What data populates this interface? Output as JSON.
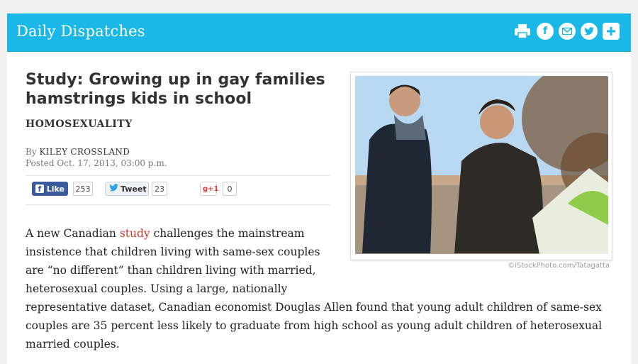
{
  "header": {
    "brand": "Daily Dispatches",
    "icons": [
      "printer-icon",
      "facebook-icon",
      "email-icon",
      "twitter-icon",
      "plus-icon"
    ]
  },
  "article": {
    "title_line1": "Study: Growing up in gay families",
    "title_line2": "hamstrings kids in school",
    "category": "HOMOSEXUALITY",
    "by_label": "By",
    "author": "KILEY CROSSLAND",
    "posted": "Posted Oct. 17, 2013, 03:00 p.m.",
    "photo_credit": "©iStockPhoto.com/Tatagatta",
    "body": {
      "l1_pre": "A new Canadian ",
      "l1_link": "study",
      "l1_post": " challenges the mainstream",
      "l2": "insistence that children living with same-sex couples",
      "l3": "are “no different” than children living with married,",
      "l4": "heterosexual couples. Using a large, nationally",
      "l5": "representative dataset, Canadian economist Douglas Allen found that young adult children of same-sex",
      "l6": "couples are 35 percent less likely to graduate from high school as young adult children of heterosexual",
      "l7": "married couples."
    }
  },
  "social": {
    "like_label": "Like",
    "like_count": "253",
    "tweet_label": "Tweet",
    "tweet_count": "23",
    "gplus_label": "g+1",
    "gplus_count": "0"
  },
  "colors": {
    "header_bg": "#1bb8e7",
    "link": "#c8392b",
    "facebook": "#3b5a9b"
  }
}
